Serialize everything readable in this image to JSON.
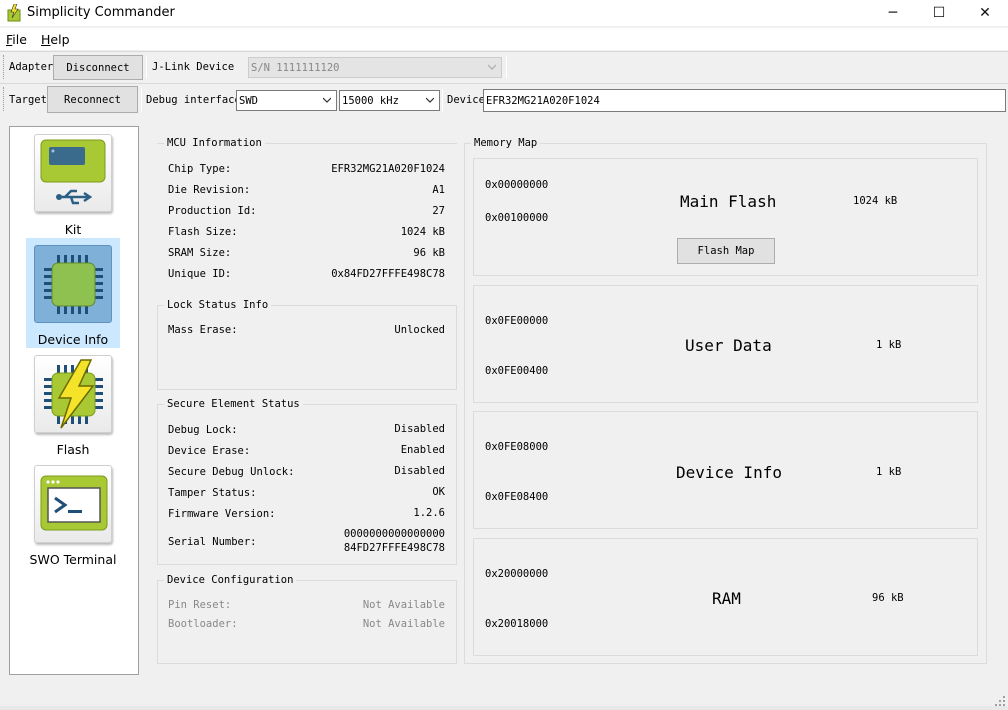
{
  "window": {
    "title": "Simplicity Commander",
    "minimize_glyph": "─",
    "maximize_glyph": "☐",
    "close_glyph": "✕"
  },
  "menubar": {
    "file": {
      "mnemonic": "F",
      "rest": "ile"
    },
    "help": {
      "mnemonic": "H",
      "rest": "elp"
    }
  },
  "adapter_bar": {
    "label": "Adapter",
    "disconnect_button": "Disconnect",
    "jlink_label": "J-Link Device",
    "jlink_value": "S/N 1111111120"
  },
  "target_bar": {
    "label": "Target",
    "reconnect_button": "Reconnect",
    "debug_interface_label": "Debug interface",
    "debug_interface_value": "SWD",
    "speed_value": "15000 kHz",
    "device_label": "Device",
    "device_value": "EFR32MG21A020F1024"
  },
  "nav": {
    "items": [
      {
        "label": "Kit",
        "icon": "kit-usb-icon",
        "selected": false
      },
      {
        "label": "Device Info",
        "icon": "chip-icon",
        "selected": true
      },
      {
        "label": "Flash",
        "icon": "flash-chip-icon",
        "selected": false
      },
      {
        "label": "SWO Terminal",
        "icon": "terminal-icon",
        "selected": false
      }
    ]
  },
  "mcu_info": {
    "title": "MCU Information",
    "rows": [
      {
        "label": "Chip Type:",
        "value": "EFR32MG21A020F1024"
      },
      {
        "label": "Die Revision:",
        "value": "A1"
      },
      {
        "label": "Production Id:",
        "value": "27"
      },
      {
        "label": "Flash Size:",
        "value": "1024 kB"
      },
      {
        "label": "SRAM Size:",
        "value": "96 kB"
      },
      {
        "label": "Unique ID:",
        "value": "0x84FD27FFFE498C78"
      }
    ]
  },
  "lock_status": {
    "title": "Lock Status Info",
    "rows": [
      {
        "label": "Mass Erase:",
        "value": "Unlocked"
      }
    ]
  },
  "secure_element": {
    "title": "Secure Element Status",
    "rows": [
      {
        "label": "Debug Lock:",
        "value": "Disabled"
      },
      {
        "label": "Device Erase:",
        "value": "Enabled"
      },
      {
        "label": "Secure Debug Unlock:",
        "value": "Disabled"
      },
      {
        "label": "Tamper Status:",
        "value": "OK"
      },
      {
        "label": "Firmware Version:",
        "value": "1.2.6"
      }
    ],
    "serial": {
      "label": "Serial Number:",
      "line1": "0000000000000000",
      "line2": "84FD27FFFE498C78"
    }
  },
  "device_config": {
    "title": "Device Configuration",
    "rows": [
      {
        "label": "Pin Reset:",
        "value": "Not Available"
      },
      {
        "label": "Bootloader:",
        "value": "Not Available"
      }
    ]
  },
  "memory_map": {
    "title": "Memory Map",
    "flash_map_button": "Flash Map",
    "blocks": [
      {
        "name": "Main Flash",
        "start": "0x00000000",
        "end": "0x00100000",
        "size": "1024 kB"
      },
      {
        "name": "User Data",
        "start": "0x0FE00000",
        "end": "0x0FE00400",
        "size": "1 kB"
      },
      {
        "name": "Device Info",
        "start": "0x0FE08000",
        "end": "0x0FE08400",
        "size": "1 kB"
      },
      {
        "name": "RAM",
        "start": "0x20000000",
        "end": "0x20018000",
        "size": "96 kB"
      }
    ]
  },
  "colors": {
    "accent_green": "#a8c933",
    "selected_bg": "#cce8ff",
    "lightning_yellow": "#f5e32a"
  }
}
